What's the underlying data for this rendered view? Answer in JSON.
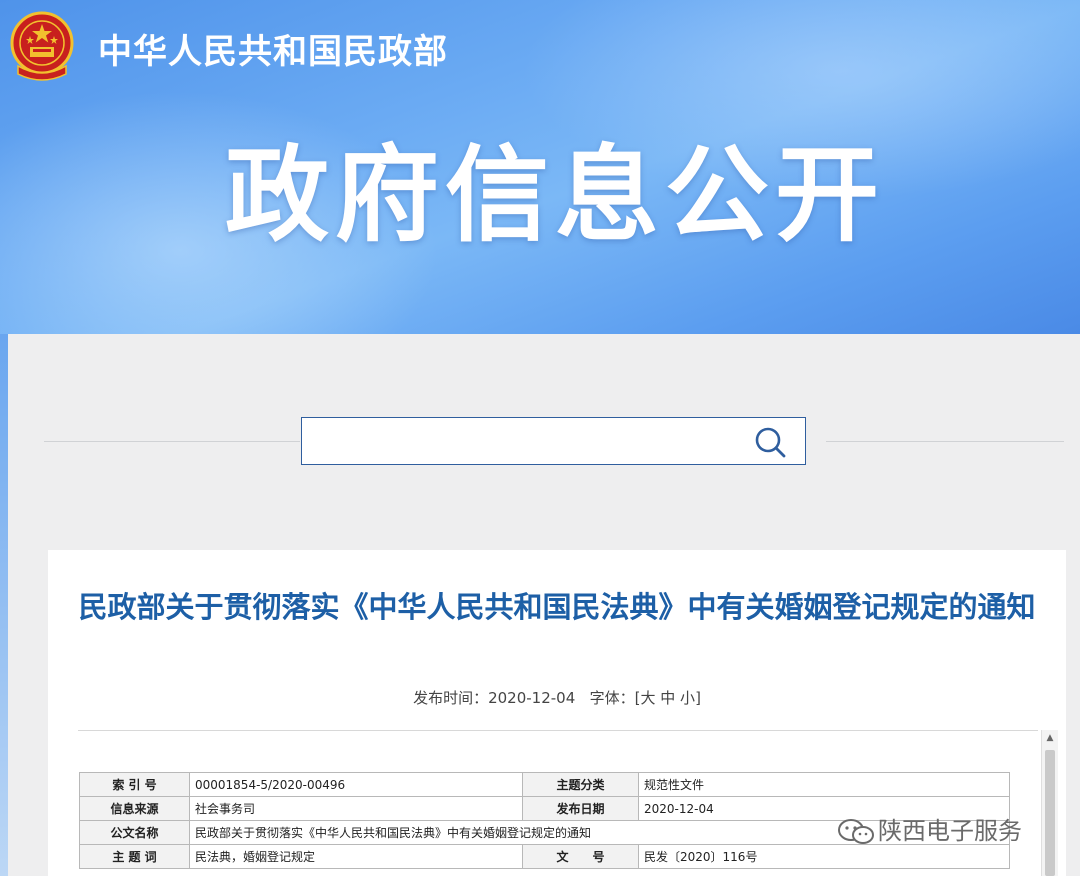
{
  "header": {
    "ministry_name": "中华人民共和国民政部",
    "banner_title": "政府信息公开"
  },
  "search": {
    "value": "",
    "placeholder": ""
  },
  "document": {
    "title": "民政部关于贯彻落实《中华人民共和国民法典》中有关婚姻登记规定的通知",
    "publish_label": "发布时间：",
    "publish_date": "2020-12-04",
    "font_label": "字体：[",
    "font_large": "大",
    "font_medium": "中",
    "font_small": "小",
    "font_close": "]"
  },
  "info_table": {
    "rows": [
      {
        "label1": "索 引 号",
        "value1": "00001854-5/2020-00496",
        "label2": "主题分类",
        "value2": "规范性文件"
      },
      {
        "label1": "信息来源",
        "value1": "社会事务司",
        "label2": "发布日期",
        "value2": "2020-12-04"
      },
      {
        "label1": "公文名称",
        "value1": "民政部关于贯彻落实《中华人民共和国民法典》中有关婚姻登记规定的通知"
      },
      {
        "label1": "主 题 词",
        "value1": "民法典，婚姻登记规定",
        "label2": "文　　号",
        "value2": "民发〔2020〕116号"
      }
    ]
  },
  "watermark": {
    "text": "陕西电子服务"
  },
  "colors": {
    "title_blue": "#1d5fa6",
    "banner_blue": "#5c9ef0",
    "emblem_red": "#c8201e",
    "emblem_gold": "#f2c12e"
  },
  "icons": [
    "national-emblem-icon",
    "search-icon",
    "scroll-up-arrow-icon",
    "wechat-icon"
  ]
}
